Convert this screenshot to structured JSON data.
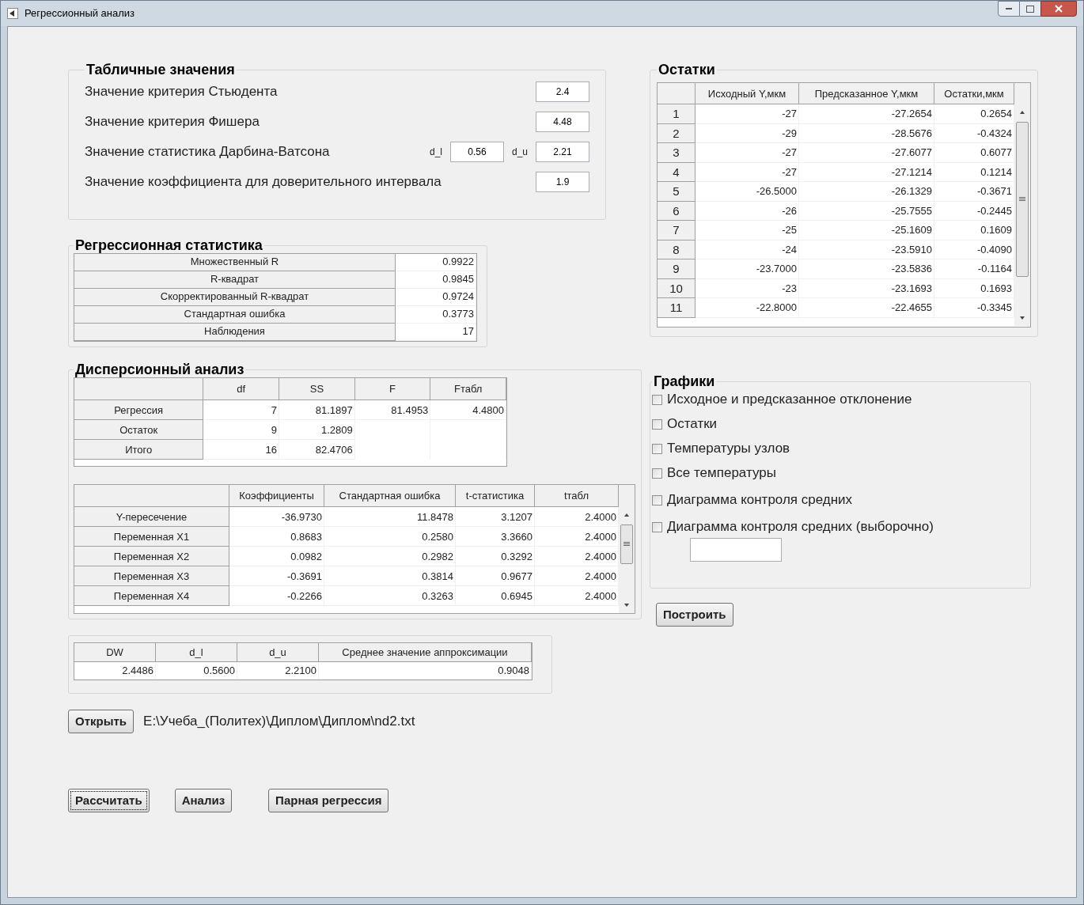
{
  "window": {
    "title": "Регрессионный анализ"
  },
  "tabular_values": {
    "title": "Табличные значения",
    "rows": [
      {
        "kind": "single",
        "label": "Значение критерия Стьюдента",
        "value": "2.4"
      },
      {
        "kind": "single",
        "label": "Значение критерия Фишера",
        "value": "4.48"
      },
      {
        "kind": "pair",
        "label": "Значение статистика Дарбина-Ватсона",
        "fields": [
          {
            "label": "d_l",
            "value": "0.56"
          },
          {
            "label": "d_u",
            "value": "2.21"
          }
        ]
      },
      {
        "kind": "single",
        "label": "Значение коэффициента для доверительного интервала",
        "value": "1.9"
      }
    ]
  },
  "regression_statistics": {
    "title": "Регрессионная статистика",
    "rows": [
      {
        "label": "Множественный R",
        "value": "0.9922"
      },
      {
        "label": "R-квадрат",
        "value": "0.9845"
      },
      {
        "label": "Скорректированный R-квадрат",
        "value": "0.9724"
      },
      {
        "label": "Стандартная ошибка",
        "value": "0.3773"
      },
      {
        "label": "Наблюдения",
        "value": "17"
      }
    ]
  },
  "anova": {
    "title": "Дисперсионный анализ",
    "table": {
      "columns": [
        "df",
        "SS",
        "F",
        "Fтабл"
      ],
      "rows": [
        {
          "label": "Регрессия",
          "cells": [
            "7",
            "81.1897",
            "81.4953",
            "4.4800"
          ]
        },
        {
          "label": "Остаток",
          "cells": [
            "9",
            "1.2809"
          ]
        },
        {
          "label": "Итого",
          "cells": [
            "16",
            "82.4706"
          ]
        }
      ]
    },
    "coefficients": {
      "columns": [
        "Коэффициенты",
        "Стандартная ошибка",
        "t-статистика",
        "tтабл"
      ],
      "rows": [
        {
          "label": "Y-пересечение",
          "cells": [
            "-36.9730",
            "11.8478",
            "3.1207",
            "2.4000"
          ]
        },
        {
          "label": "Переменная X1",
          "cells": [
            "0.8683",
            "0.2580",
            "3.3660",
            "2.4000"
          ]
        },
        {
          "label": "Переменная X2",
          "cells": [
            "0.0982",
            "0.2982",
            "0.3292",
            "2.4000"
          ]
        },
        {
          "label": "Переменная X3",
          "cells": [
            "-0.3691",
            "0.3814",
            "0.9677",
            "2.4000"
          ]
        },
        {
          "label": "Переменная X4",
          "cells": [
            "-0.2266",
            "0.3263",
            "0.6945",
            "2.4000"
          ]
        }
      ]
    }
  },
  "durbin_watson": {
    "columns": [
      "DW",
      "d_l",
      "d_u",
      "Среднее значение аппроксимации"
    ],
    "values": [
      "2.4486",
      "0.5600",
      "2.2100",
      "0.9048"
    ]
  },
  "open_button": "Открыть",
  "file_path": "E:\\Учеба_(Политех)\\Диплом\\Диплом\\nd2.txt",
  "action_buttons": [
    {
      "label": "Рассчитать",
      "focused": true
    },
    {
      "label": "Анализ",
      "focused": false
    },
    {
      "label": "Парная регрессия",
      "focused": false
    }
  ],
  "residuals": {
    "title": "Остатки",
    "columns": [
      "Исходный Y,мкм",
      "Предсказанное Y,мкм",
      "Остатки,мкм"
    ],
    "rows": [
      {
        "index": "1",
        "cells": [
          "-27",
          "-27.2654",
          "0.2654"
        ]
      },
      {
        "index": "2",
        "cells": [
          "-29",
          "-28.5676",
          "-0.4324"
        ]
      },
      {
        "index": "3",
        "cells": [
          "-27",
          "-27.6077",
          "0.6077"
        ]
      },
      {
        "index": "4",
        "cells": [
          "-27",
          "-27.1214",
          "0.1214"
        ]
      },
      {
        "index": "5",
        "cells": [
          "-26.5000",
          "-26.1329",
          "-0.3671"
        ]
      },
      {
        "index": "6",
        "cells": [
          "-26",
          "-25.7555",
          "-0.2445"
        ]
      },
      {
        "index": "7",
        "cells": [
          "-25",
          "-25.1609",
          "0.1609"
        ]
      },
      {
        "index": "8",
        "cells": [
          "-24",
          "-23.5910",
          "-0.4090"
        ]
      },
      {
        "index": "9",
        "cells": [
          "-23.7000",
          "-23.5836",
          "-0.1164"
        ]
      },
      {
        "index": "10",
        "cells": [
          "-23",
          "-23.1693",
          "0.1693"
        ]
      },
      {
        "index": "11",
        "cells": [
          "-22.8000",
          "-22.4655",
          "-0.3345"
        ]
      }
    ]
  },
  "charts": {
    "title": "Графики",
    "options": [
      {
        "label": "Исходное и предсказанное отклонение",
        "checked": false
      },
      {
        "label": "Остатки",
        "checked": false
      },
      {
        "label": "Температуры узлов",
        "checked": false
      },
      {
        "label": "Все температуры",
        "checked": false
      },
      {
        "label": "Диаграмма контроля средних",
        "checked": false
      },
      {
        "label": "Диаграмма контроля средних (выборочно)",
        "checked": false
      }
    ]
  },
  "build_button": "Построить"
}
